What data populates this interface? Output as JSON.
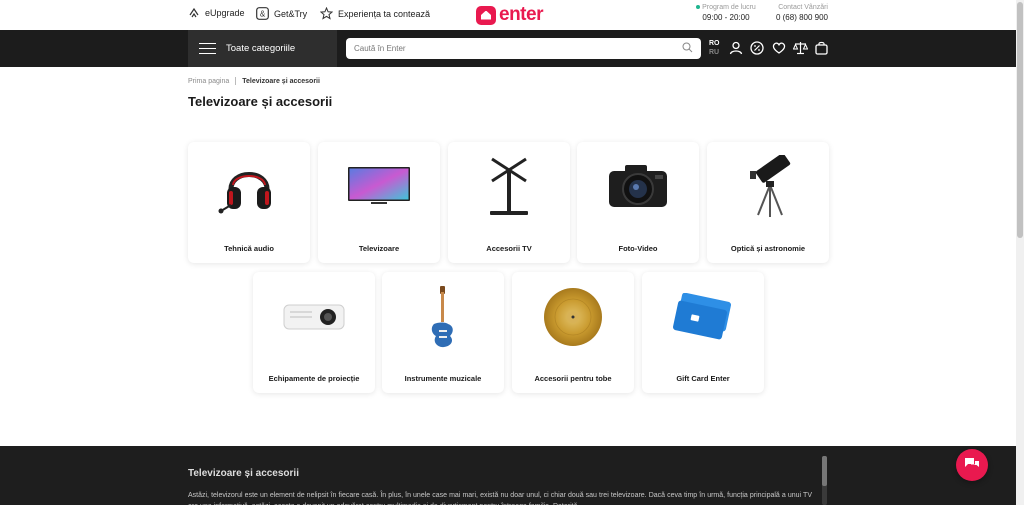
{
  "topbar": {
    "links": [
      {
        "label": "eUpgrade",
        "icon": "upgrade-icon"
      },
      {
        "label": "Get&Try",
        "icon": "get-try-icon"
      },
      {
        "label": "Experiența ta contează",
        "icon": "star-icon"
      }
    ],
    "logo_text": "enter",
    "hours_label": "Program de lucru",
    "hours_value": "09:00 - 20:00",
    "contact_label": "Contact Vânzări",
    "contact_value": "0 (68) 800 900"
  },
  "navbar": {
    "categories_label": "Toate categoriile",
    "search_placeholder": "Caută în Enter",
    "lang_active": "RO",
    "lang_inactive": "RU",
    "icons": [
      "user-icon",
      "discount-icon",
      "heart-icon",
      "compare-icon",
      "cart-icon"
    ]
  },
  "breadcrumb": {
    "home": "Prima pagina",
    "current": "Televizoare și accesorii"
  },
  "page_title": "Televizoare și accesorii",
  "categories": [
    {
      "label": "Tehnică audio"
    },
    {
      "label": "Televizoare"
    },
    {
      "label": "Accesorii TV"
    },
    {
      "label": "Foto-Video"
    },
    {
      "label": "Optică și astronomie"
    },
    {
      "label": "Echipamente de proiecție"
    },
    {
      "label": "Instrumente muzicale"
    },
    {
      "label": "Accesorii pentru tobe"
    },
    {
      "label": "Gift Card Enter"
    }
  ],
  "seo": {
    "title": "Televizoare și accesorii",
    "text": "Astăzi, televizorul este un element de nelipsit în fiecare casă. În plus, în unele case mai mari, există nu doar unul, ci chiar două sau trei televizoare. Dacă ceva timp în urmă, funcția principală a unui TV era una informativă, astăzi, acesta a devenit un adevărat centru multimedia și de divertisment pentru întreaga familie. Datorită"
  },
  "colors": {
    "brand": "#e9194f",
    "nav_bg": "#1c1c1c",
    "status_dot": "#1fb58f"
  }
}
